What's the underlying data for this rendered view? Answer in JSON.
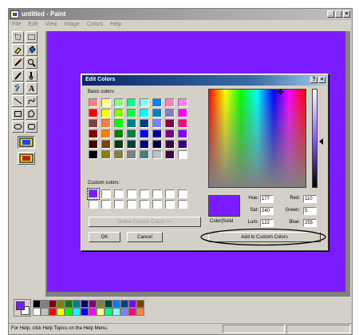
{
  "window": {
    "title": "untitled - Paint",
    "controls": {
      "minimize": "_",
      "maximize": "□",
      "close": "×"
    }
  },
  "menubar": [
    "File",
    "Edit",
    "View",
    "Image",
    "Colors",
    "Help"
  ],
  "canvas": {
    "fill_color": "#7a1cff"
  },
  "current_colors": {
    "foreground": "#7a1cff",
    "background": "#ffffff"
  },
  "palette": [
    "#000000",
    "#808080",
    "#800000",
    "#808000",
    "#008000",
    "#008080",
    "#000080",
    "#800080",
    "#808040",
    "#004040",
    "#0080ff",
    "#004080",
    "#8000ff",
    "#804000",
    "#ffffff",
    "#c0c0c0",
    "#ff0000",
    "#ffff00",
    "#00ff00",
    "#00ffff",
    "#0000ff",
    "#ff00ff",
    "#ffff80",
    "#00ff80",
    "#80ffff",
    "#8080ff",
    "#ff0080",
    "#ff8040"
  ],
  "status": {
    "text": "For Help, click Help Topics on the Help Menu."
  },
  "dialog": {
    "title": "Edit Colors",
    "help_button": "?",
    "close_button": "×",
    "basic_colors_label": "Basic colors:",
    "custom_colors_label": "Custom colors:",
    "basic_colors": [
      "#ff8080",
      "#ffff80",
      "#80ff80",
      "#00ff80",
      "#80ffff",
      "#0080ff",
      "#ff80c0",
      "#ff80ff",
      "#ff0000",
      "#ffff00",
      "#80ff00",
      "#00ff40",
      "#00ffff",
      "#0080c0",
      "#8080c0",
      "#ff00ff",
      "#804040",
      "#ff8040",
      "#00ff00",
      "#008080",
      "#004080",
      "#8080ff",
      "#800040",
      "#ff0080",
      "#800000",
      "#ff8000",
      "#008000",
      "#008040",
      "#0000ff",
      "#0000a0",
      "#800080",
      "#8000ff",
      "#400000",
      "#804000",
      "#004000",
      "#004040",
      "#000080",
      "#000040",
      "#400040",
      "#400080",
      "#000000",
      "#808000",
      "#808040",
      "#808080",
      "#408080",
      "#c0c0c0",
      "#400040",
      "#ffffff"
    ],
    "custom_colors": [
      "#7a1cff",
      "#ffffff",
      "#ffffff",
      "#ffffff",
      "#ffffff",
      "#ffffff",
      "#ffffff",
      "#ffffff",
      "#ffffff",
      "#ffffff",
      "#ffffff",
      "#ffffff",
      "#ffffff",
      "#ffffff",
      "#ffffff",
      "#ffffff"
    ],
    "define_custom_button": "Define Custom Colors >>",
    "ok_button": "OK",
    "cancel_button": "Cancel",
    "color_solid_label": "Color|Solid",
    "selected_color": "#7a1cff",
    "add_to_custom_button": "Add to Custom Colors",
    "fields": {
      "hue": {
        "label": "Hue:",
        "value": "177"
      },
      "sat": {
        "label": "Sat:",
        "value": "240"
      },
      "lum": {
        "label": "Lum:",
        "value": "122"
      },
      "red": {
        "label": "Red:",
        "value": "110"
      },
      "green": {
        "label": "Green:",
        "value": "5"
      },
      "blue": {
        "label": "Blue:",
        "value": "255"
      }
    }
  }
}
